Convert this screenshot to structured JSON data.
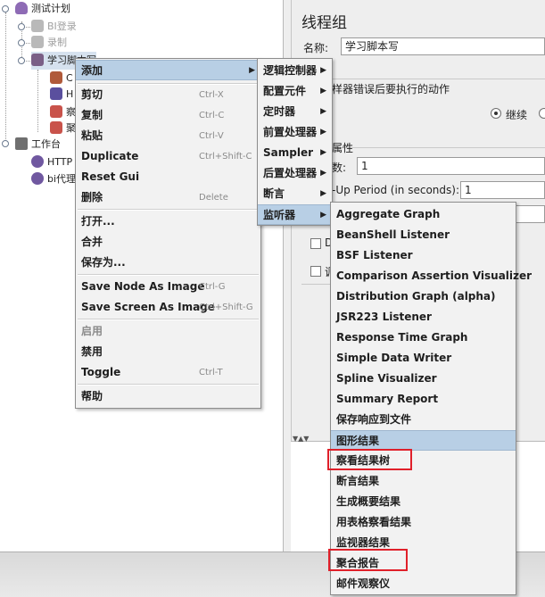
{
  "tree": {
    "items": [
      {
        "label": "测试计划"
      },
      {
        "label": "BI登录"
      },
      {
        "label": "录制"
      },
      {
        "label": "学习脚本写"
      },
      {
        "label": "C"
      },
      {
        "label": "H"
      },
      {
        "label": "察"
      },
      {
        "label": "聚"
      },
      {
        "label": "工作台"
      },
      {
        "label": "HTTP"
      },
      {
        "label": "bi代理"
      }
    ]
  },
  "panel": {
    "title": "线程组",
    "name_label": "名称:",
    "name_value": "学习脚本写",
    "error_action_label": "样器错误后要执行的动作",
    "continue_label": "继续",
    "properties_label": "属性",
    "threads_label": "数:",
    "threads_value": "1",
    "rampup_label": "-Up Period (in seconds):",
    "rampup_value": "1",
    "loop_check_label": "D",
    "sched_check_label": "调"
  },
  "context_menu": {
    "items": [
      {
        "label": "添加",
        "shortcut": "",
        "submenu": true
      },
      {
        "label": "剪切",
        "shortcut": "Ctrl-X"
      },
      {
        "label": "复制",
        "shortcut": "Ctrl-C"
      },
      {
        "label": "粘贴",
        "shortcut": "Ctrl-V"
      },
      {
        "label": "Duplicate",
        "shortcut": "Ctrl+Shift-C"
      },
      {
        "label": "Reset Gui",
        "shortcut": ""
      },
      {
        "label": "删除",
        "shortcut": "Delete"
      },
      {
        "label": "打开...",
        "shortcut": ""
      },
      {
        "label": "合并",
        "shortcut": ""
      },
      {
        "label": "保存为...",
        "shortcut": ""
      },
      {
        "label": "Save Node As Image",
        "shortcut": "Ctrl-G"
      },
      {
        "label": "Save Screen As Image",
        "shortcut": "Ctrl+Shift-G"
      },
      {
        "label": "启用",
        "shortcut": ""
      },
      {
        "label": "禁用",
        "shortcut": ""
      },
      {
        "label": "Toggle",
        "shortcut": "Ctrl-T"
      },
      {
        "label": "帮助",
        "shortcut": ""
      }
    ]
  },
  "add_submenu": {
    "items": [
      {
        "label": "逻辑控制器"
      },
      {
        "label": "配置元件"
      },
      {
        "label": "定时器"
      },
      {
        "label": "前置处理器"
      },
      {
        "label": "Sampler"
      },
      {
        "label": "后置处理器"
      },
      {
        "label": "断言"
      },
      {
        "label": "监听器"
      }
    ]
  },
  "listener_submenu": {
    "items": [
      {
        "label": "Aggregate Graph"
      },
      {
        "label": "BeanShell Listener"
      },
      {
        "label": "BSF Listener"
      },
      {
        "label": "Comparison Assertion Visualizer"
      },
      {
        "label": "Distribution Graph (alpha)"
      },
      {
        "label": "JSR223 Listener"
      },
      {
        "label": "Response Time Graph"
      },
      {
        "label": "Simple Data Writer"
      },
      {
        "label": "Spline Visualizer"
      },
      {
        "label": "Summary Report"
      },
      {
        "label": "保存响应到文件"
      },
      {
        "label": "图形结果"
      },
      {
        "label": "察看结果树"
      },
      {
        "label": "断言结果"
      },
      {
        "label": "生成概要结果"
      },
      {
        "label": "用表格察看结果"
      },
      {
        "label": "监视器结果"
      },
      {
        "label": "聚合报告"
      },
      {
        "label": "邮件观察仪"
      }
    ]
  },
  "colors": {
    "highlight": "#b8cfe5",
    "annotation_box": "#e0202a"
  }
}
